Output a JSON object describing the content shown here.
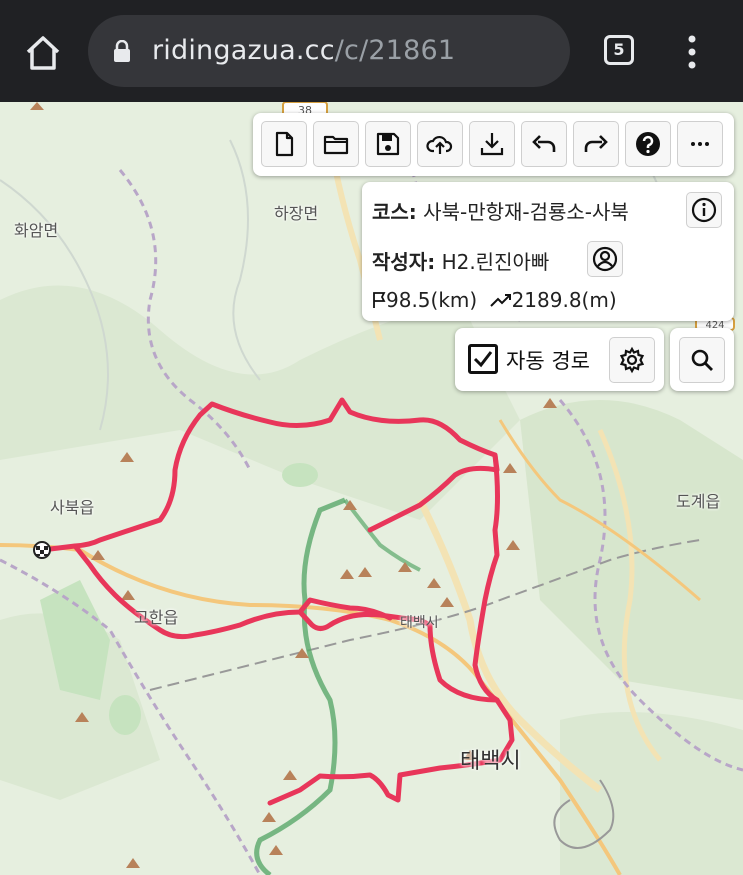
{
  "browser": {
    "url_domain": "ridingazua.cc",
    "url_path": "/c/21861",
    "tab_count": "5"
  },
  "map": {
    "places": [
      {
        "name": "화암면"
      },
      {
        "name": "하장면"
      },
      {
        "name": "사북읍"
      },
      {
        "name": "고한읍"
      },
      {
        "name": "태백시"
      },
      {
        "name": "태백시"
      },
      {
        "name": "도계읍"
      }
    ],
    "road_shields": [
      "38",
      "424"
    ],
    "route_color": "#e8365a",
    "forest_boundary_color": "#5aa86a"
  },
  "toolbar": {
    "buttons": [
      "new-file-icon",
      "open-folder-icon",
      "save-icon",
      "cloud-upload-icon",
      "download-icon",
      "undo-icon",
      "redo-icon",
      "help-icon",
      "more-icon"
    ]
  },
  "course": {
    "course_label": "코스:",
    "course_name": "사북-만항재-검룡소-사북",
    "author_label": "작성자:",
    "author_name": "H2.린진아빠",
    "distance": "98.5(km)",
    "elevation": "2189.8(m)"
  },
  "auto_route": {
    "label": "자동 경로",
    "checked": true
  }
}
